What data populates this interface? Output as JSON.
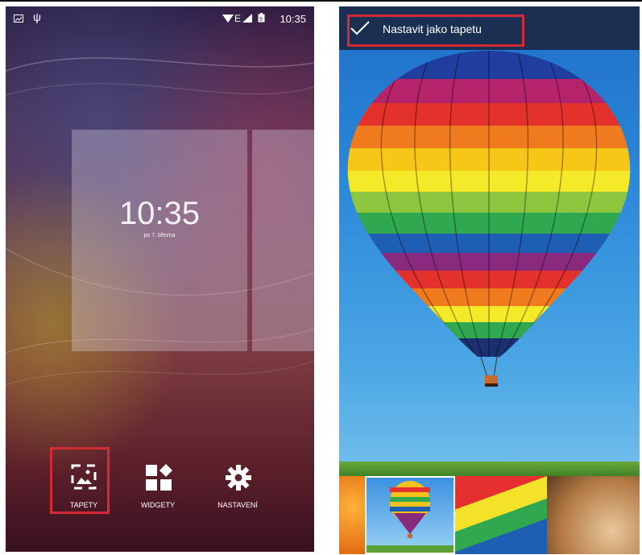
{
  "left": {
    "statusbar": {
      "time": "10:35"
    },
    "clock": {
      "time": "10:35",
      "date": "po 7. března"
    },
    "dock": [
      {
        "label": "TAPETY",
        "icon": "wallpaper-icon"
      },
      {
        "label": "WIDGETY",
        "icon": "widgets-icon"
      },
      {
        "label": "NASTAVENÍ",
        "icon": "gear-icon"
      }
    ],
    "highlight_color": "#d42a36"
  },
  "right": {
    "action_bar": {
      "label": "Nastavit jako tapetu",
      "icon": "checkmark-icon"
    },
    "thumbnails": [
      "oranges-wallpaper",
      "balloon-wallpaper",
      "rainbow-stripes-wallpaper",
      "cymbal-wallpaper"
    ]
  }
}
